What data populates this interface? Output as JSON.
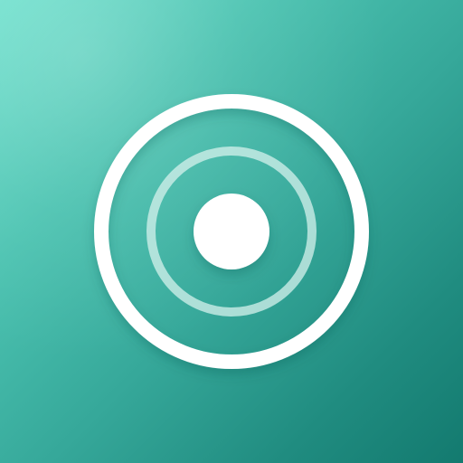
{
  "app_icon": {
    "icon_name": "target-radar-icon",
    "colors": {
      "gradient_start": "#6fe0cd",
      "gradient_mid": "#36a89a",
      "gradient_end": "#137a6f",
      "foreground": "#ffffff",
      "inner_ring": "#d6f1ec"
    }
  }
}
